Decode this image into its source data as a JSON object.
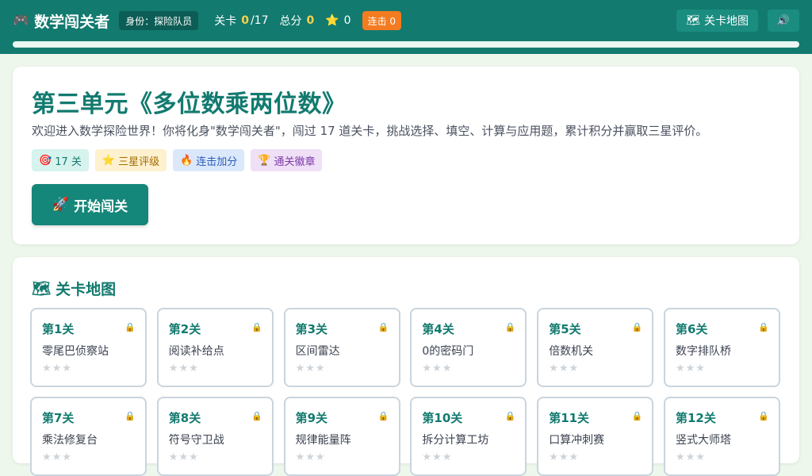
{
  "header": {
    "brand_icon": "🎮",
    "brand": "数学闯关者",
    "role": "身份：探险队员",
    "level_label": "关卡",
    "level_done": "0",
    "level_total": "/17",
    "score_label": "总分",
    "score_value": "0",
    "star_icon": "⭐",
    "star_value": "0",
    "combo": "连击 0",
    "map_icon": "🗺",
    "map_button": "关卡地图",
    "sound_icon": "🔊",
    "progress": 0
  },
  "hero": {
    "title": "第三单元《多位数乘两位数》",
    "desc": "欢迎进入数学探险世界！你将化身\"数学闯关者\"，闯过 17 道关卡，挑战选择、填空、计算与应用题，累计积分并赢取三星评价。",
    "tags": [
      {
        "icon": "🎯",
        "label": "17 关"
      },
      {
        "icon": "⭐",
        "label": "三星评级"
      },
      {
        "icon": "🔥",
        "label": "连击加分"
      },
      {
        "icon": "🏆",
        "label": "通关徽章"
      }
    ],
    "start_icon": "🚀",
    "start_label": "开始闯关"
  },
  "map": {
    "icon": "🗺",
    "title": "关卡地图",
    "lock_icon": "🔒",
    "stars": "★★★",
    "levels": [
      {
        "num": "第1关",
        "name": "零尾巴侦察站"
      },
      {
        "num": "第2关",
        "name": "阅读补给点"
      },
      {
        "num": "第3关",
        "name": "区间雷达"
      },
      {
        "num": "第4关",
        "name": "0的密码门"
      },
      {
        "num": "第5关",
        "name": "倍数机关"
      },
      {
        "num": "第6关",
        "name": "数字排队桥"
      },
      {
        "num": "第7关",
        "name": "乘法修复台"
      },
      {
        "num": "第8关",
        "name": "符号守卫战"
      },
      {
        "num": "第9关",
        "name": "规律能量阵"
      },
      {
        "num": "第10关",
        "name": "拆分计算工坊"
      },
      {
        "num": "第11关",
        "name": "口算冲刺赛"
      },
      {
        "num": "第12关",
        "name": "竖式大师塔"
      }
    ]
  }
}
